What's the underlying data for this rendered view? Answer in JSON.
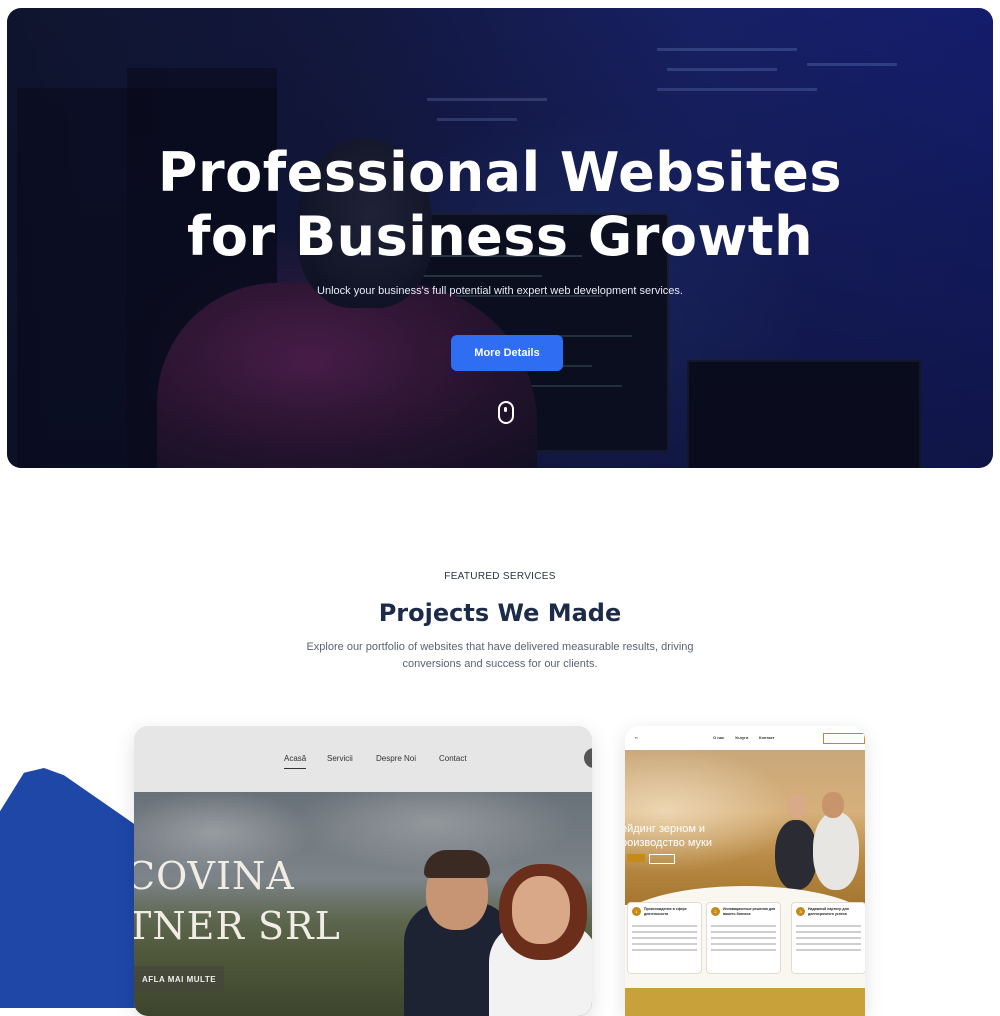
{
  "hero": {
    "title_line1": "Professional Websites",
    "title_line2": "for Business Growth",
    "subtitle": "Unlock your business's full potential with expert web development services.",
    "cta_label": "More Details",
    "scroll_indicator": "mouse-scroll-icon"
  },
  "services": {
    "eyebrow": "FEATURED SERVICES",
    "title": "Projects We Made",
    "description": "Explore our portfolio of websites that have delivered measurable results, driving conversions and success for our clients."
  },
  "project1": {
    "nav": [
      "Acasă",
      "Servicii",
      "Despre Noi",
      "Contact"
    ],
    "headline_line1": "COVINA",
    "headline_line2": "TNER SRL",
    "cta_label": "AFLA MAI MULTE"
  },
  "project2": {
    "nav": [
      "О нас",
      "Услуги",
      "Контакт"
    ],
    "hero_line1": "ейдинг зерном и",
    "hero_line2": "роизводство муки",
    "features": [
      {
        "num": "1",
        "title": "Происхождение в сфере деятельности"
      },
      {
        "num": "2",
        "title": "Инновационные решения для вашего бизнеса"
      },
      {
        "num": "3",
        "title": "Надежный партнер для долгосрочного успеха"
      }
    ]
  },
  "colors": {
    "accent": "#2f6df2",
    "title_dark": "#1c2b4a",
    "decor_blue": "#1f47a8"
  }
}
